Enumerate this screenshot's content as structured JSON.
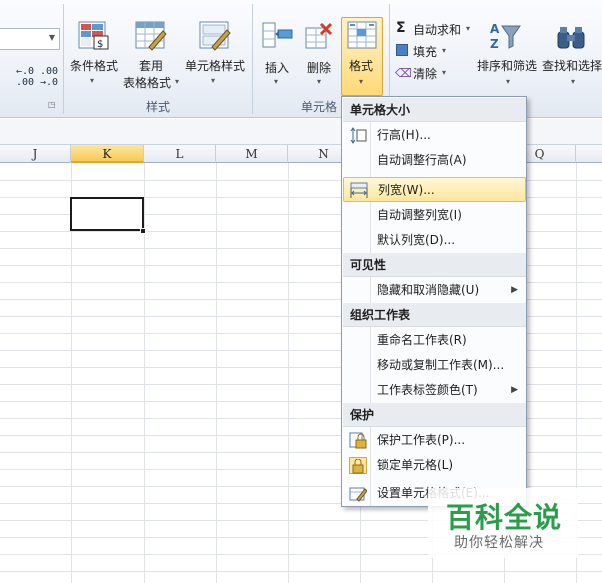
{
  "ribbon": {
    "styles_group": {
      "label": "样式",
      "conditional_format": "条件格式",
      "table_format_line1": "套用",
      "table_format_line2": "表格格式",
      "cell_styles": "单元格样式"
    },
    "number_group": {
      "inc_decimal": "←.0 .00",
      "dec_decimal": ".00 →.0"
    },
    "cells_group": {
      "label": "单元格",
      "insert": "插入",
      "delete": "删除",
      "format": "格式"
    },
    "editing_group": {
      "autosum": "自动求和",
      "fill": "填充",
      "clear": "清除",
      "sort_filter": "排序和筛选",
      "find_select": "查找和选择"
    }
  },
  "columns": [
    "J",
    "K",
    "L",
    "M",
    "N",
    "Q"
  ],
  "active_column": "K",
  "menu": {
    "sections": [
      {
        "header": "单元格大小",
        "items": [
          {
            "label": "行高(H)...",
            "icon": "row-height-icon",
            "submenu": false
          },
          {
            "label": "自动调整行高(A)",
            "icon": "",
            "submenu": false
          },
          {
            "label": "列宽(W)...",
            "icon": "column-width-icon",
            "submenu": false,
            "hover": true
          },
          {
            "label": "自动调整列宽(I)",
            "icon": "",
            "submenu": false
          },
          {
            "label": "默认列宽(D)...",
            "icon": "",
            "submenu": false
          }
        ]
      },
      {
        "header": "可见性",
        "items": [
          {
            "label": "隐藏和取消隐藏(U)",
            "icon": "",
            "submenu": true
          }
        ]
      },
      {
        "header": "组织工作表",
        "items": [
          {
            "label": "重命名工作表(R)",
            "icon": "",
            "submenu": false
          },
          {
            "label": "移动或复制工作表(M)...",
            "icon": "",
            "submenu": false
          },
          {
            "label": "工作表标签颜色(T)",
            "icon": "",
            "submenu": true
          }
        ]
      },
      {
        "header": "保护",
        "items": [
          {
            "label": "保护工作表(P)...",
            "icon": "protect-sheet-icon",
            "submenu": false
          },
          {
            "label": "锁定单元格(L)",
            "icon": "lock-cell-icon",
            "submenu": false
          },
          {
            "label": "设置单元格格式(E)...",
            "icon": "format-cells-icon",
            "submenu": false
          }
        ]
      }
    ]
  },
  "watermark": {
    "title": "百科全说",
    "subtitle": "助你轻松解决"
  },
  "colors": {
    "accent_hover": "#ffe69a",
    "watermark_green": "#2a9d4a"
  }
}
